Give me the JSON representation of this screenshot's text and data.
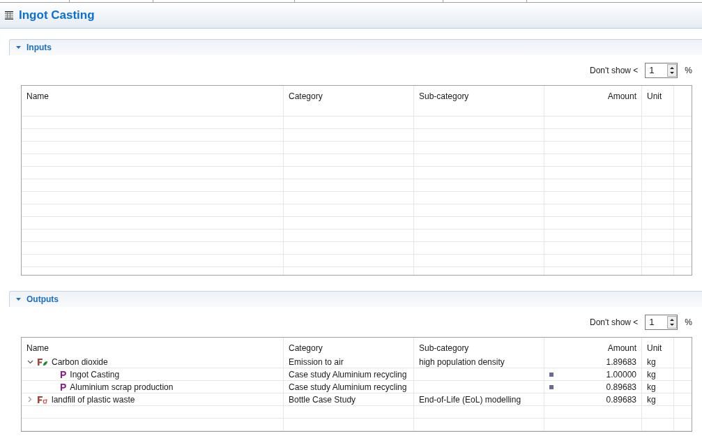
{
  "window": {
    "title": "Ingot Casting"
  },
  "sections": [
    {
      "title": "Inputs",
      "expanded": true,
      "filter": {
        "label": "Don't show <",
        "value": "1",
        "unit": "%"
      },
      "table": {
        "columns": [
          "Name",
          "Category",
          "Sub-category",
          "Amount",
          "Unit"
        ]
      }
    },
    {
      "title": "Outputs",
      "expanded": true,
      "filter": {
        "label": "Don't show <",
        "value": "1",
        "unit": "%"
      },
      "table": {
        "columns": [
          "Name",
          "Category",
          "Sub-category",
          "Amount",
          "Unit"
        ],
        "rows": [
          {
            "kind": "elementary_flow",
            "name": "Carbon dioxide",
            "category": "Emission to air",
            "sub_category": "high population density",
            "amount": "1.89683",
            "unit": "kg",
            "expanded": true,
            "children": [
              {
                "kind": "process",
                "icon_letter": "P",
                "name": "Ingot Casting",
                "category": "Case study Aluminium recycling",
                "amount": "1.00000",
                "unit": "kg"
              },
              {
                "kind": "process",
                "icon_letter": "P",
                "name": "Aluminium scrap production",
                "category": "Case study Aluminium recycling",
                "amount": "0.89683",
                "unit": "kg"
              }
            ]
          },
          {
            "kind": "waste_flow",
            "name": "landfill of plastic waste",
            "category": "Bottle Case Study",
            "sub_category": "End-of-Life (EoL) modelling",
            "amount": "0.89683",
            "unit": "kg",
            "expanded": false,
            "children": []
          }
        ]
      }
    }
  ]
}
